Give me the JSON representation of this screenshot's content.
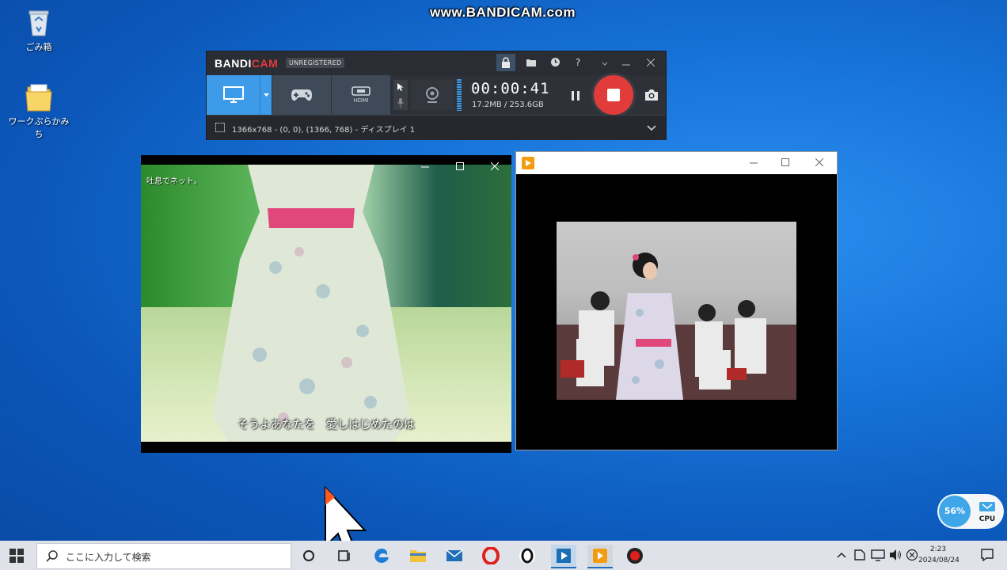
{
  "watermark": "www.BANDICAM.com",
  "desktop": {
    "icons": [
      {
        "label": "ごみ箱",
        "icon": "recycle-bin-icon"
      },
      {
        "label": "ワークぷらかみち",
        "icon": "folder-icon"
      }
    ]
  },
  "bandicam": {
    "logo_main": "BANDI",
    "logo_accent": "CAM",
    "badge": "UNREGISTERED",
    "timer": "00:00:41",
    "size": "17.2MB / 253.6GB",
    "area_text": "1366x768 - (0, 0), (1366, 768) - ディスプレイ 1",
    "mode_labels": {
      "hdmi": "HDMI"
    },
    "title_buttons": [
      "lock",
      "folder",
      "clock",
      "help"
    ],
    "help_label": "?",
    "colors": {
      "accent": "#e23b3b",
      "active_mode": "#3d9be9"
    }
  },
  "left_player": {
    "caption_top": "吐息でネット。",
    "subtitle": "そうよあなたを　愛しはじめたのは"
  },
  "right_player": {
    "icon": "media-player-icon"
  },
  "taskbar": {
    "search_placeholder": "ここに入力して検索",
    "time": "2:23",
    "date": "2024/08/24",
    "apps": [
      "cortana-icon",
      "task-view-icon",
      "edge-icon",
      "explorer-icon",
      "mail-icon",
      "opera-icon",
      "opera-gx-icon",
      "media-player-icon",
      "vlc-icon",
      "bandicam-icon"
    ]
  },
  "cpu_widget": {
    "percent": "56%",
    "label": "CPU"
  }
}
